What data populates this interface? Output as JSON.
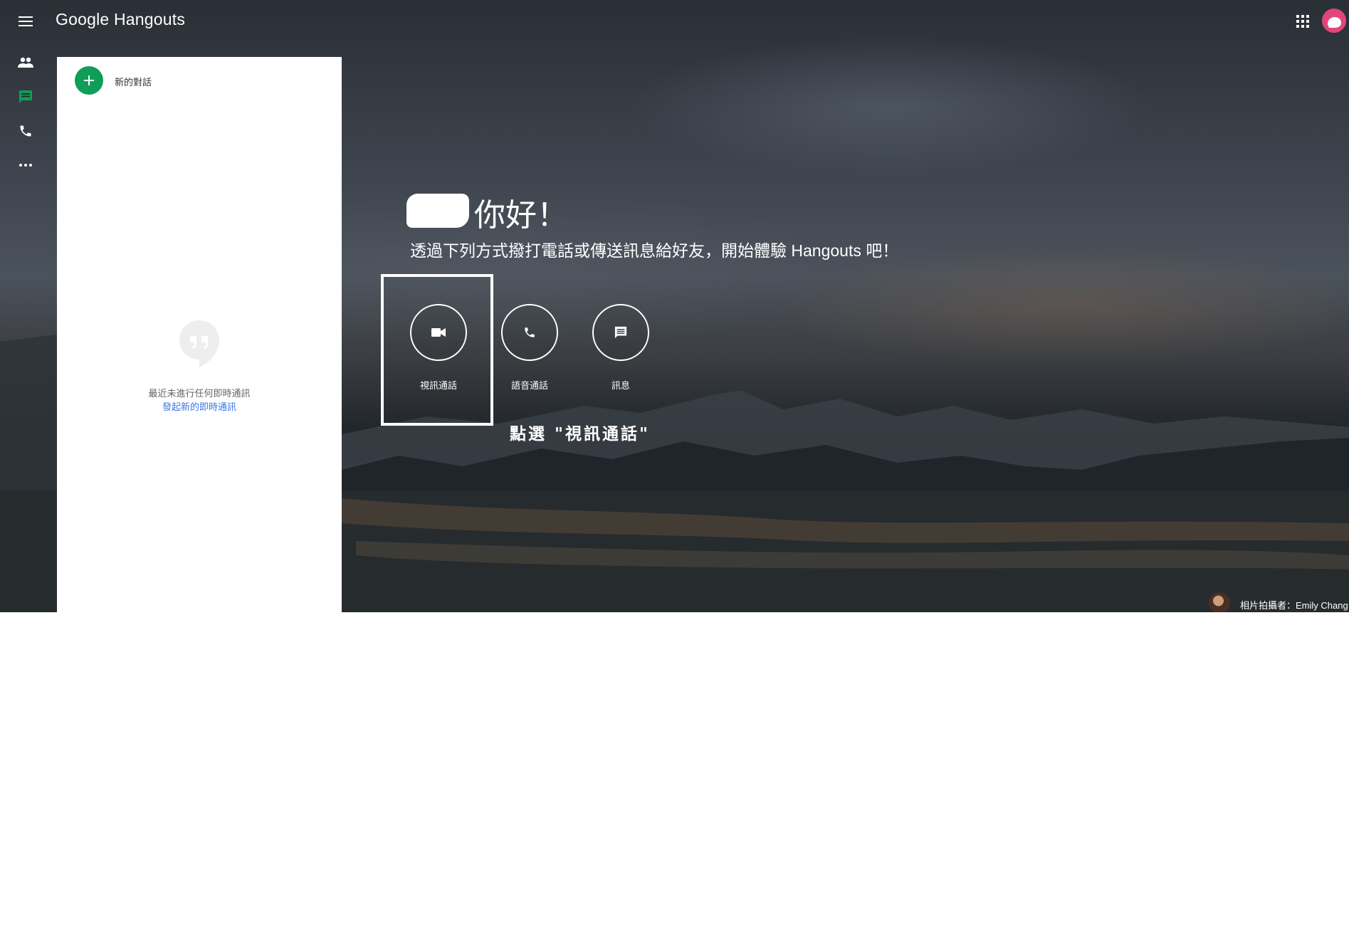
{
  "app": {
    "logo_text": "Google Hangouts",
    "menu_icon": "hamburger-menu-icon",
    "apps_icon": "apps-grid-icon",
    "account_avatar": "account-avatar"
  },
  "nav_rail": {
    "items": [
      {
        "name": "contacts",
        "icon": "people-icon"
      },
      {
        "name": "conversations",
        "icon": "chat-icon",
        "active": true
      },
      {
        "name": "phone-calls",
        "icon": "phone-icon"
      },
      {
        "name": "more",
        "icon": "more-horiz-icon"
      }
    ],
    "active_color": "#0f9d58"
  },
  "panel": {
    "new_conversation_label": "新的對話",
    "new_conversation_icon": "plus-icon",
    "empty_icon": "hangouts-quote-icon",
    "empty_message": "最近未進行任何即時通訊",
    "empty_action_link": "發起新的即時通訊"
  },
  "welcome": {
    "greeting": "你好！",
    "subtitle": "透過下列方式撥打電話或傳送訊息給好友，開始體驗 Hangouts 吧！",
    "actions": [
      {
        "label": "視訊通話",
        "icon": "videocam-icon",
        "highlighted": true
      },
      {
        "label": "語音通話",
        "icon": "phone-icon"
      },
      {
        "label": "訊息",
        "icon": "message-icon"
      }
    ],
    "hint": "點選 \"視訊通話\""
  },
  "photo_credit": "相片拍攝者：Emily Chang",
  "colors": {
    "brand_green": "#0f9d58",
    "link_blue": "#3b78e7",
    "avatar_pink": "#e0457b"
  }
}
